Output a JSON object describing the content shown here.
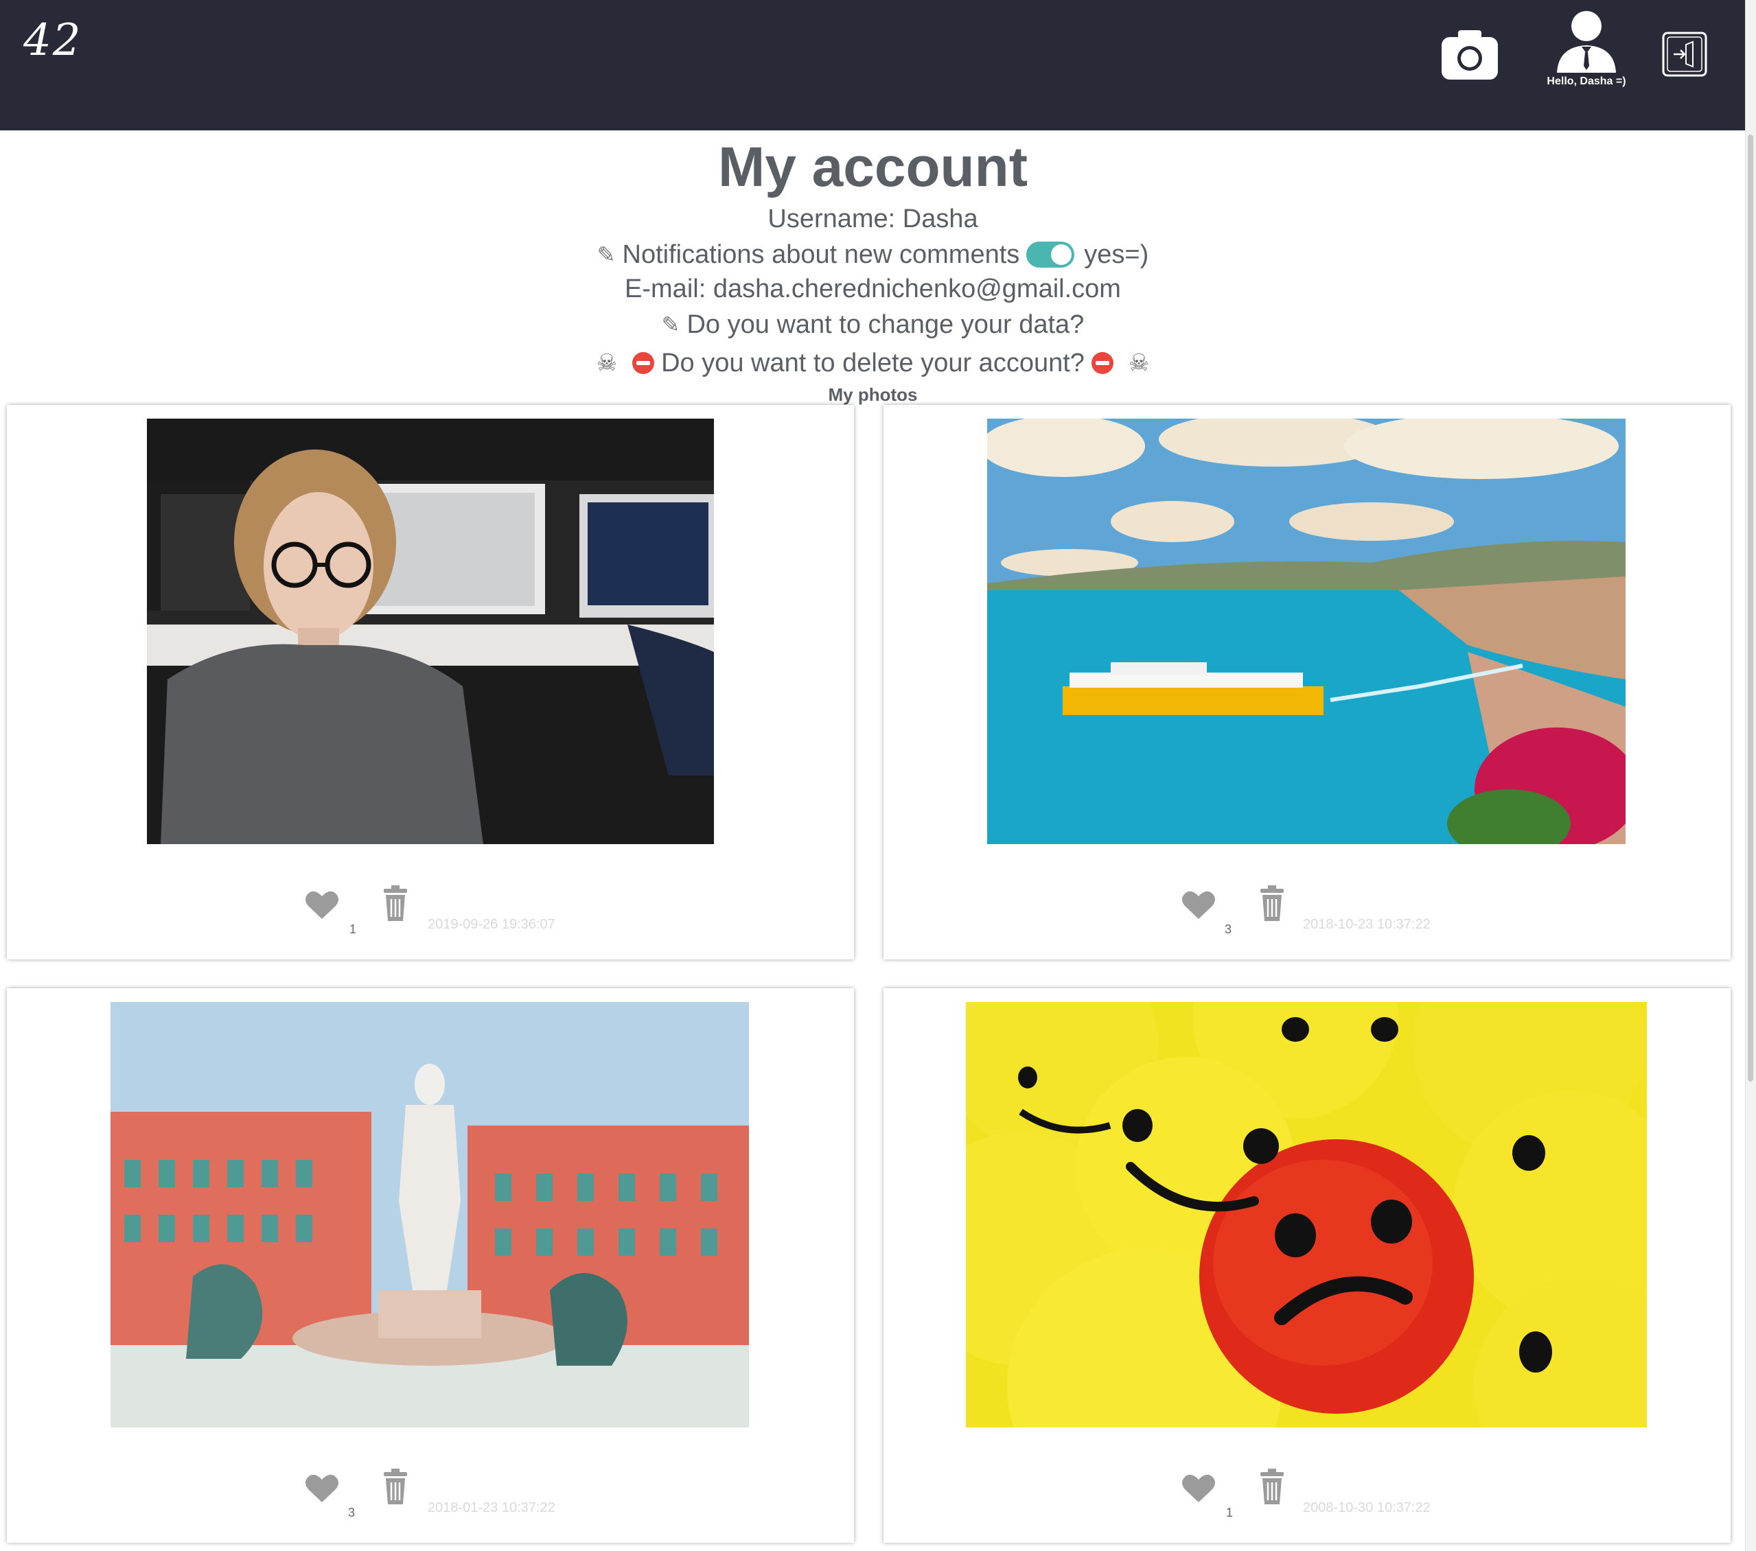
{
  "header": {
    "logo": "42",
    "greeting": "Hello, Dasha =)"
  },
  "account": {
    "title": "My account",
    "username_line": "Username: Dasha",
    "notifications_label": "Notifications about new comments",
    "notifications_enabled": true,
    "notifications_value": "yes=)",
    "email_line": "E-mail: dasha.cherednichenko@gmail.com",
    "change_data_label": "Do you want to change your data?",
    "delete_account_label": "Do you want to delete your account?",
    "photos_heading": "My photos"
  },
  "icons": {
    "pencil": "✎",
    "skull": "☠"
  },
  "colors": {
    "header_bg": "#282b37",
    "toggle_on": "#4bb6b0",
    "text": "#5a5f66",
    "stop_sign": "#e8453c"
  },
  "photos": [
    {
      "subject": "woman-at-desk",
      "likes": "1",
      "date": "2019-09-26 19:36:07"
    },
    {
      "subject": "seaside-ferry",
      "likes": "3",
      "date": "2018-10-23 10:37:22"
    },
    {
      "subject": "statue-fountain",
      "likes": "3",
      "date": "2018-01-23 10:37:22"
    },
    {
      "subject": "smiley-balls",
      "likes": "1",
      "date": "2008-10-30 10:37:22"
    }
  ]
}
